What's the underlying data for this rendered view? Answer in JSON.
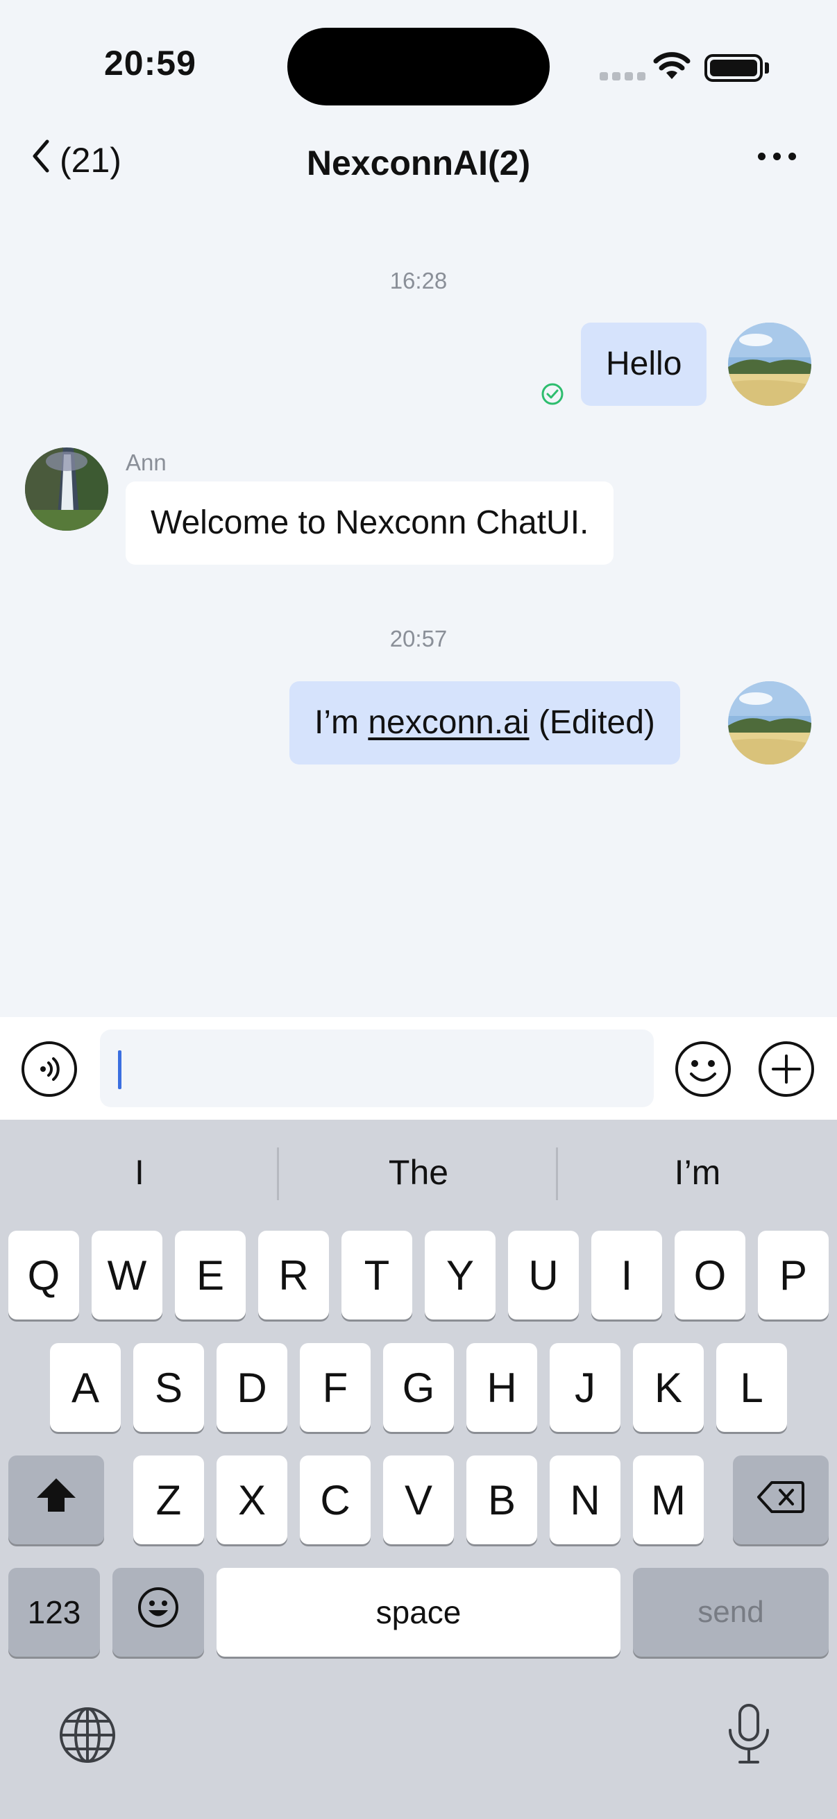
{
  "status_bar": {
    "time": "20:59"
  },
  "nav": {
    "back_count": "(21)",
    "title": "NexconnAI(2)"
  },
  "messages": [
    {
      "type": "timestamp",
      "text": "16:28"
    },
    {
      "type": "outgoing",
      "text": "Hello",
      "status": "read"
    },
    {
      "type": "incoming",
      "sender": "Ann",
      "text": "Welcome to Nexconn ChatUI."
    },
    {
      "type": "timestamp",
      "text": "20:57"
    },
    {
      "type": "outgoing",
      "text_prefix": "I’m ",
      "link": "nexconn.ai",
      "text_suffix": " (Edited)"
    }
  ],
  "input": {
    "value": ""
  },
  "keyboard": {
    "suggestions": [
      "I",
      "The",
      "I’m"
    ],
    "rows": [
      [
        "Q",
        "W",
        "E",
        "R",
        "T",
        "Y",
        "U",
        "I",
        "O",
        "P"
      ],
      [
        "A",
        "S",
        "D",
        "F",
        "G",
        "H",
        "J",
        "K",
        "L"
      ],
      [
        "Z",
        "X",
        "C",
        "V",
        "B",
        "N",
        "M"
      ]
    ],
    "numbers_label": "123",
    "space_label": "space",
    "send_label": "send"
  },
  "colors": {
    "background": "#f2f5f9",
    "outgoing_bubble": "#d6e3fc",
    "incoming_bubble": "#ffffff",
    "read_check": "#2dbd6e",
    "cursor": "#3b6fe0",
    "keyboard_bg": "#d1d4db"
  }
}
